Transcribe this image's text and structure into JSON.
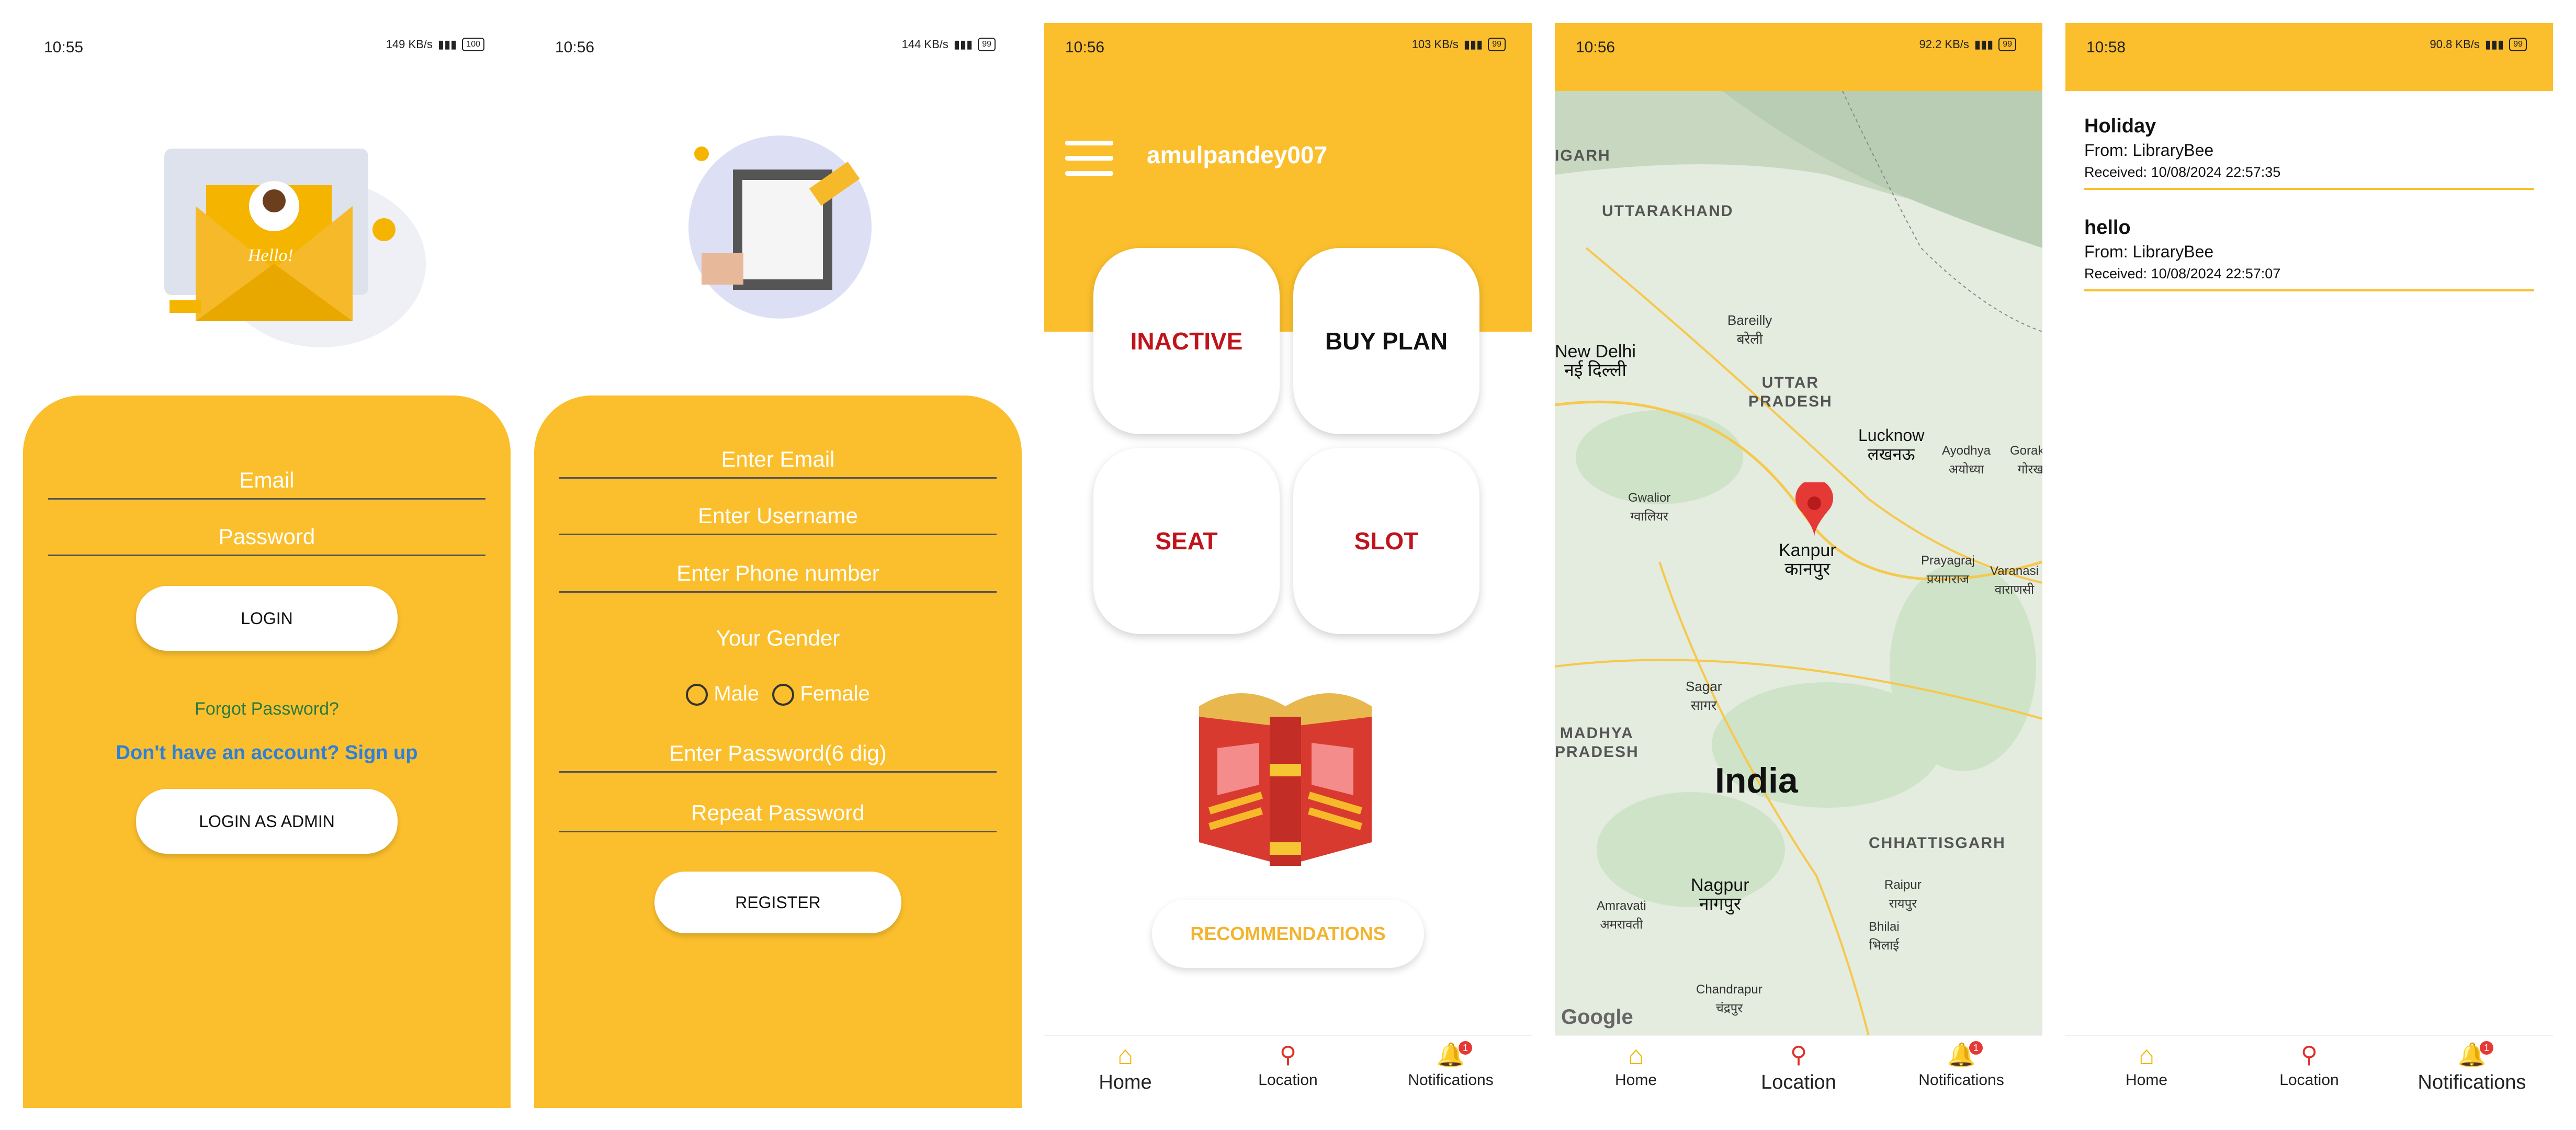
{
  "screens": {
    "login": {
      "time": "10:55",
      "net": "149 KB/s",
      "battery": "100",
      "illustration_text": "Hello!",
      "email_placeholder": "Email",
      "password_placeholder": "Password",
      "login_label": "LOGIN",
      "forgot": "Forgot Password?",
      "signup": "Don't have an account? Sign up",
      "admin_label": "LOGIN AS ADMIN"
    },
    "register": {
      "time": "10:56",
      "net": "144 KB/s",
      "battery": "99",
      "email_placeholder": "Enter Email",
      "username_placeholder": "Enter Username",
      "phone_placeholder": "Enter Phone number",
      "gender_label": "Your Gender",
      "male": "Male",
      "female": "Female",
      "password_placeholder": "Enter Password(6 dig)",
      "repeat_placeholder": "Repeat Password",
      "register_label": "REGISTER"
    },
    "home": {
      "time": "10:56",
      "net": "103 KB/s",
      "battery": "99",
      "username": "amulpandey007",
      "tiles": [
        "INACTIVE",
        "BUY PLAN",
        "SEAT",
        "SLOT"
      ],
      "recommendations": "RECOMMENDATIONS"
    },
    "map": {
      "time": "10:56",
      "net": "92.2 KB/s",
      "battery": "99",
      "labels": {
        "garh": "IGARH",
        "uttarakhand": "UTTARAKHAND",
        "bareilly": "Bareilly\nबरेली",
        "newdelhi": "New Delhi\nनई दिल्ली",
        "uttarpradesh": "UTTAR\nPRADESH",
        "lucknow": "Lucknow\nलखनऊ",
        "ayodhya": "Ayodhya\nअयोध्या",
        "gorakh": "Gorakh\nगोरख",
        "gwalior": "Gwalior\nग्वालियर",
        "kanpur": "Kanpur\nकानपुर",
        "prayagraj": "Prayagraj\nप्रयागराज",
        "varanasi": "Varanasi\nवाराणसी",
        "sagar": "Sagar\nसागर",
        "madhya": "MADHYA\nPRADESH",
        "india": "India",
        "chhattisgarh": "CHHATTISGARH",
        "amravati": "Amravati\nअमरावती",
        "nagpur": "Nagpur\nनागपुर",
        "raipur": "Raipur\nरायपुर",
        "bhilai": "Bhilai\nभिलाई",
        "chandrapur": "Chandrapur\nचंद्रपुर",
        "google": "Google"
      }
    },
    "notifications": {
      "time": "10:58",
      "net": "90.8 KB/s",
      "battery": "99",
      "items": [
        {
          "title": "Holiday",
          "from": "From: LibraryBee",
          "received": "Received: 10/08/2024 22:57:35"
        },
        {
          "title": "hello",
          "from": "From: LibraryBee",
          "received": "Received: 10/08/2024 22:57:07"
        }
      ]
    }
  },
  "nav": {
    "home": "Home",
    "location": "Location",
    "notifications": "Notifications",
    "badge": "1"
  },
  "colors": {
    "brand_yellow": "#fbbf2d",
    "accent_red": "#c0141c",
    "link_blue": "#2f7fd8",
    "link_green": "#2b7a3d"
  }
}
